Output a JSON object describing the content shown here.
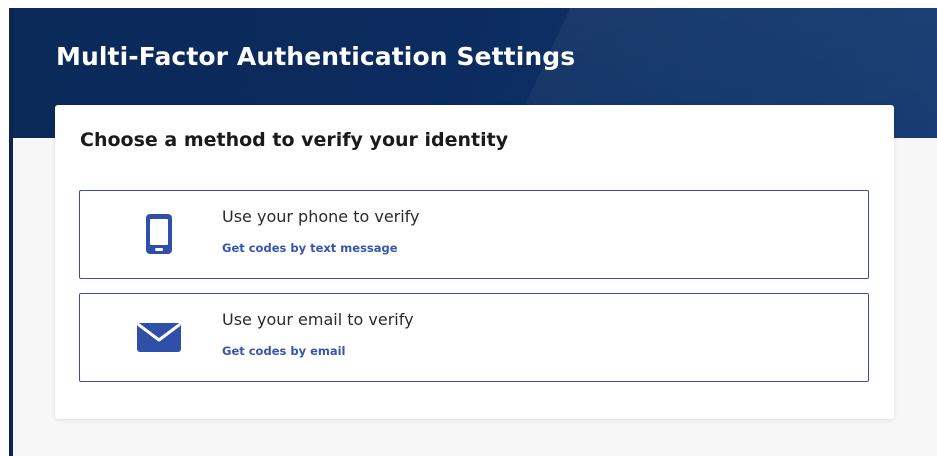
{
  "header": {
    "title": "Multi-Factor Authentication Settings"
  },
  "card": {
    "heading": "Choose a method to verify your identity",
    "options": [
      {
        "icon": "phone-icon",
        "title": "Use your phone to verify",
        "subtitle": "Get codes by text message"
      },
      {
        "icon": "email-icon",
        "title": "Use your email to verify",
        "subtitle": "Get codes by email"
      }
    ]
  },
  "colors": {
    "banner": "#0b2b5e",
    "accent": "#2f4fa8",
    "option_border": "#3a4f9c",
    "link": "#3655b0"
  }
}
